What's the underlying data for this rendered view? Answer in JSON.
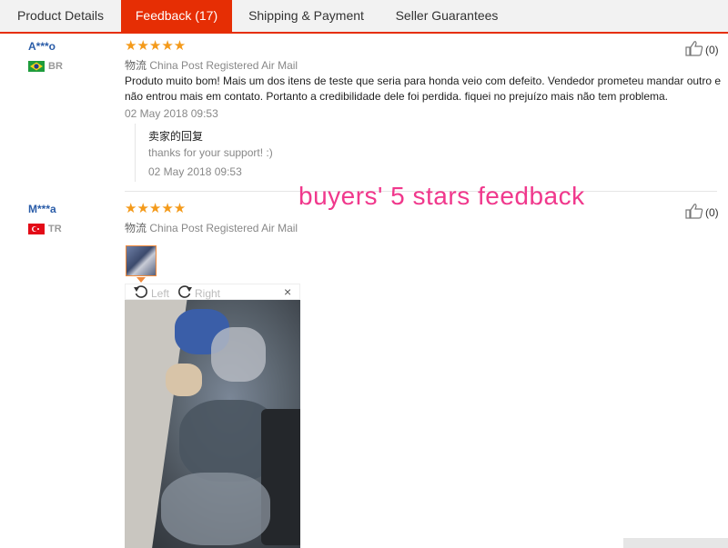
{
  "tabs": [
    {
      "label": "Product Details"
    },
    {
      "label": "Feedback (17)"
    },
    {
      "label": "Shipping & Payment"
    },
    {
      "label": "Seller Guarantees"
    }
  ],
  "reviews": [
    {
      "buyer": "A***o",
      "country": "BR",
      "stars": "★★★★★",
      "shipping_label": "物流",
      "shipping": "China Post Registered Air Mail",
      "text_line1": "Produto muito bom! Mais um dos itens de teste que seria para honda veio com defeito. Vendedor prometeu mandar outro e",
      "text_line2": "não entrou mais em contato. Portanto a credibilidade dele foi perdida. fiquei no prejuízo mais não tem problema.",
      "date": "02 May 2018 09:53",
      "reply_title": "卖家的回复",
      "reply_text": "thanks for your support! :)",
      "reply_date": "02 May 2018 09:53",
      "helpful": "(0)"
    },
    {
      "buyer": "M***a",
      "country": "TR",
      "stars": "★★★★★",
      "shipping_label": "物流",
      "shipping": "China Post Registered Air Mail",
      "helpful": "(0)",
      "rotate_left": "Left",
      "rotate_right": "Right",
      "close": "×"
    }
  ],
  "overlay_text": "buyers' 5 stars feedback",
  "colors": {
    "accent": "#e62e04",
    "star": "#f49a1a",
    "overlay": "#f0388c",
    "buyer": "#2a5ca8"
  }
}
